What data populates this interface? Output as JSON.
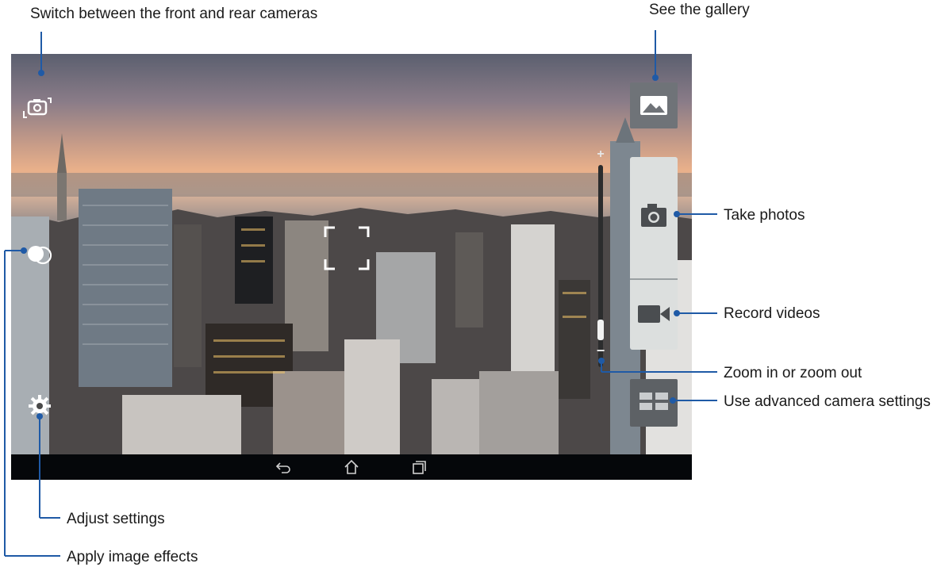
{
  "callouts": {
    "switch_cameras": "Switch between the front and rear cameras",
    "gallery": "See the gallery",
    "take_photos": "Take photos",
    "record_videos": "Record videos",
    "zoom": "Zoom in or zoom out",
    "advanced_settings": "Use advanced camera settings",
    "adjust_settings": "Adjust settings",
    "image_effects": "Apply image effects"
  },
  "zoom": {
    "plus_symbol": "+",
    "minus_symbol": "−",
    "level": 0.15
  },
  "icons": {
    "switch": "camera-switch-icon",
    "effects": "effects-icon",
    "settings": "gear-icon",
    "gallery": "gallery-icon",
    "photo": "camera-icon",
    "video": "video-camera-icon",
    "advanced": "grid-icon",
    "focus": "focus-frame-icon",
    "nav_back": "back-icon",
    "nav_home": "home-icon",
    "nav_recent": "recent-apps-icon"
  },
  "colors": {
    "leader_line": "#1f5aa6",
    "panel": "#dcdfde",
    "dark_button": "#5d6165"
  }
}
